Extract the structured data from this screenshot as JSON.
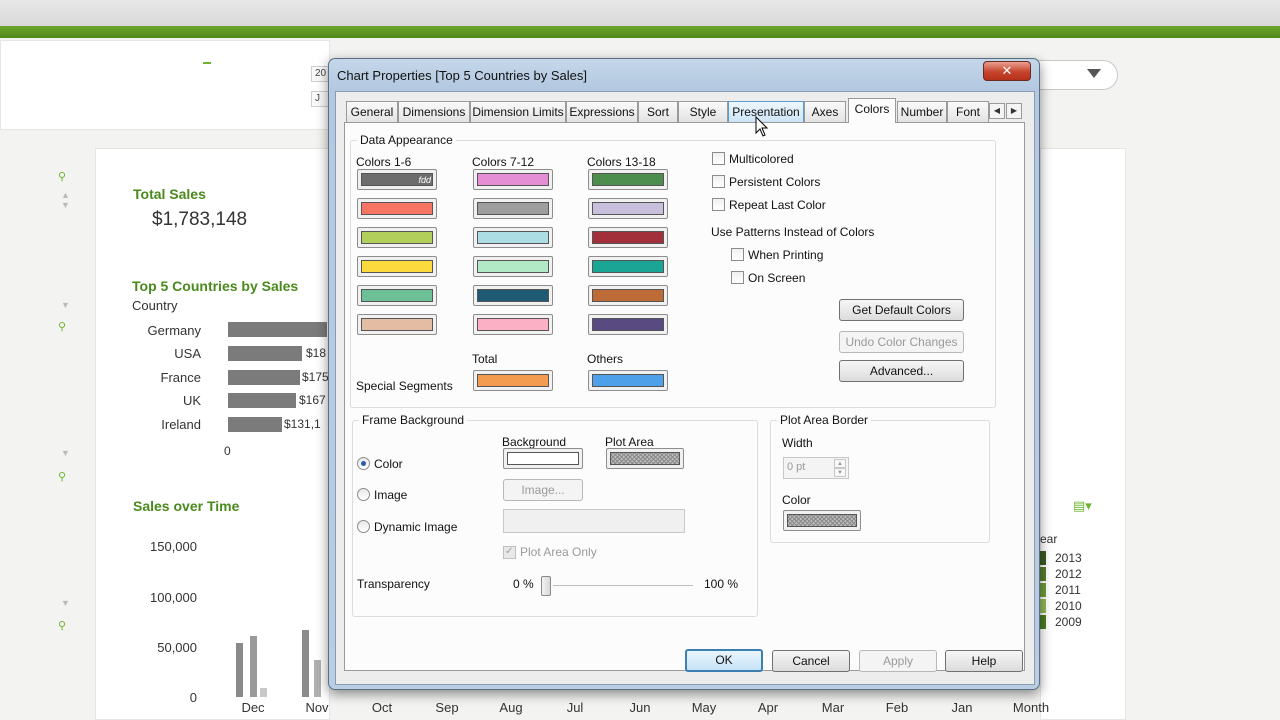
{
  "dashboard": {
    "header_fragments": [
      "20",
      "J"
    ],
    "total_sales_title": "Total Sales",
    "total_sales_value": "$1,783,148",
    "top5_title": "Top 5 Countries by Sales",
    "country_axis": "Country",
    "countries": [
      {
        "name": "Germany",
        "value": "",
        "fraction": 0.55
      },
      {
        "name": "USA",
        "value": "$18",
        "fraction": 0.41
      },
      {
        "name": "France",
        "value": "$175",
        "fraction": 0.4
      },
      {
        "name": "UK",
        "value": "$167",
        "fraction": 0.38
      },
      {
        "name": "Ireland",
        "value": "$131,1",
        "fraction": 0.3
      }
    ],
    "zero_label": "0",
    "sales_over_time_title": "Sales over Time",
    "yticks": [
      "150,000",
      "100,000",
      "50,000",
      "0"
    ],
    "months": [
      "Dec",
      "Nov",
      "Oct",
      "Sep",
      "Aug",
      "Jul",
      "Jun",
      "May",
      "Apr",
      "Mar",
      "Feb",
      "Jan",
      "Month"
    ],
    "legend_header": "ear",
    "legend_years": [
      "2013",
      "2012",
      "2011",
      "2010",
      "2009"
    ],
    "legend_colors": [
      "#3b5a22",
      "#557d2e",
      "#6e9a3b",
      "#8fb85a",
      "#4a7d21"
    ],
    "accent_color": "#4a8a1c"
  },
  "dialog": {
    "title": "Chart Properties [Top 5 Countries by Sales]",
    "close_label": "✕",
    "tabs": [
      "General",
      "Dimensions",
      "Dimension Limits",
      "Expressions",
      "Sort",
      "Style",
      "Presentation",
      "Axes",
      "Colors",
      "Number",
      "Font"
    ],
    "active_tab": "Colors",
    "hover_tab": "Presentation",
    "data_appearance": {
      "label": "Data Appearance",
      "col1_label": "Colors 1-6",
      "col2_label": "Colors 7-12",
      "col3_label": "Colors 13-18",
      "col1_colors": [
        "#6d6d6d",
        "#f87462",
        "#b1cf5a",
        "#fcd93c",
        "#6dbf98",
        "#e4bca3"
      ],
      "col2_colors": [
        "#e58ed6",
        "#9e9e9e",
        "#acdde5",
        "#b1e8c6",
        "#1f5a75",
        "#fcb0c6"
      ],
      "col3_colors": [
        "#4d8e4f",
        "#c8bfdd",
        "#a2303a",
        "#1aa595",
        "#be6c37",
        "#5a4a82"
      ],
      "first_swatch_tag": "fdd",
      "special_segments_label": "Special Segments",
      "total_label": "Total",
      "total_color": "#f39c50",
      "others_label": "Others",
      "others_color": "#4ea0e8",
      "multicolored": "Multicolored",
      "persistent_colors": "Persistent Colors",
      "repeat_last_color": "Repeat Last Color",
      "use_patterns": "Use Patterns Instead of Colors",
      "when_printing": "When Printing",
      "on_screen": "On Screen",
      "get_default_colors": "Get Default Colors",
      "undo_color_changes": "Undo Color Changes",
      "advanced": "Advanced..."
    },
    "frame_background": {
      "label": "Frame Background",
      "background_label": "Background",
      "plot_area_label": "Plot Area",
      "background_color": "#ffffff",
      "option_color": "Color",
      "option_image": "Image",
      "option_dynamic_image": "Dynamic Image",
      "selected_option": "Color",
      "image_button": "Image...",
      "plot_area_only": "Plot Area Only",
      "transparency_label": "Transparency",
      "min_label": "0 %",
      "max_label": "100 %",
      "transparency_value": 0
    },
    "plot_area_border": {
      "label": "Plot Area Border",
      "width_label": "Width",
      "width_value": "0 pt",
      "color_label": "Color"
    },
    "buttons": {
      "ok": "OK",
      "cancel": "Cancel",
      "apply": "Apply",
      "help": "Help"
    }
  }
}
